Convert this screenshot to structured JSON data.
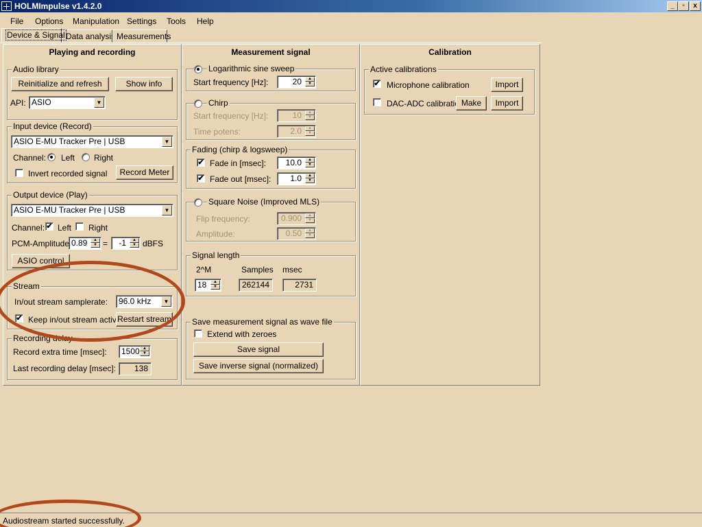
{
  "window": {
    "title": "HOLMImpulse  v1.4.2.0"
  },
  "menu": [
    "File",
    "Options",
    "Manipulation",
    "Settings",
    "Tools",
    "Help"
  ],
  "tabs": [
    "Device & Signal",
    "Data analysis",
    "Measurements"
  ],
  "panels": {
    "playing": {
      "title": "Playing and recording",
      "audio_library": {
        "label": "Audio library",
        "reinit": "Reinitialize and refresh",
        "show_info": "Show info",
        "api_label": "API:",
        "api_value": "ASIO"
      },
      "input_device": {
        "label": "Input device (Record)",
        "device": "ASIO E-MU Tracker Pre | USB",
        "channel_label": "Channel:",
        "left": "Left",
        "right": "Right",
        "invert": "Invert recorded signal",
        "record_meter": "Record Meter"
      },
      "output_device": {
        "label": "Output device (Play)",
        "device": "ASIO E-MU Tracker Pre | USB",
        "channel_label": "Channel:",
        "left": "Left",
        "right": "Right",
        "pcm_label": "PCM-Amplitude:",
        "pcm_value": "0.89",
        "equals": "=",
        "db_value": "-1",
        "dbfs": "dBFS",
        "asio_control": "ASIO control"
      },
      "stream": {
        "label": "Stream",
        "samplerate_label": "In/out stream samplerate:",
        "samplerate_value": "96.0 kHz",
        "keep_active": "Keep in/out stream active",
        "restart": "Restart stream"
      },
      "recording_delay": {
        "label": "Recording delay",
        "extra_label": "Record extra time [msec]:",
        "extra_value": "1500",
        "last_label": "Last recording delay [msec]:",
        "last_value": "138"
      }
    },
    "signal": {
      "title": "Measurement signal",
      "logsweep": {
        "label": "Logarithmic sine sweep",
        "start_label": "Start frequency [Hz]:",
        "start_value": "20"
      },
      "chirp": {
        "label": "Chirp",
        "start_label": "Start frequency [Hz]:",
        "start_value": "10",
        "potens_label": "Time potens:",
        "potens_value": "2.0"
      },
      "fading": {
        "label": "Fading (chirp & logsweep)",
        "fadein_label": "Fade in [msec]:",
        "fadein_value": "10.0",
        "fadeout_label": "Fade out [msec]:",
        "fadeout_value": "1.0"
      },
      "square": {
        "label": "Square Noise (Improved MLS)",
        "flip_label": "Flip frequency:",
        "flip_value": "0.900",
        "amp_label": "Amplitude:",
        "amp_value": "0.50"
      },
      "length": {
        "label": "Signal length",
        "col1": "2^M",
        "col2": "Samples",
        "col3": "msec",
        "m_value": "18",
        "samples_value": "262144",
        "msec_value": "2731"
      },
      "save": {
        "label": "Save measurement signal as wave file",
        "extend": "Extend with zeroes",
        "save_signal": "Save signal",
        "save_inverse": "Save inverse signal (normalized)"
      }
    },
    "calibration": {
      "title": "Calibration",
      "active": {
        "label": "Active calibrations",
        "mic": "Microphone calibration",
        "mic_import": "Import",
        "dac": "DAC-ADC calibration",
        "dac_make": "Make",
        "dac_import": "Import"
      }
    }
  },
  "status": "Audiostream started successfully.",
  "glyphs": {
    "check": "✔",
    "dd": "▼",
    "up": "▲",
    "down": "▼",
    "min": "_",
    "max": "▫",
    "close": "x"
  }
}
